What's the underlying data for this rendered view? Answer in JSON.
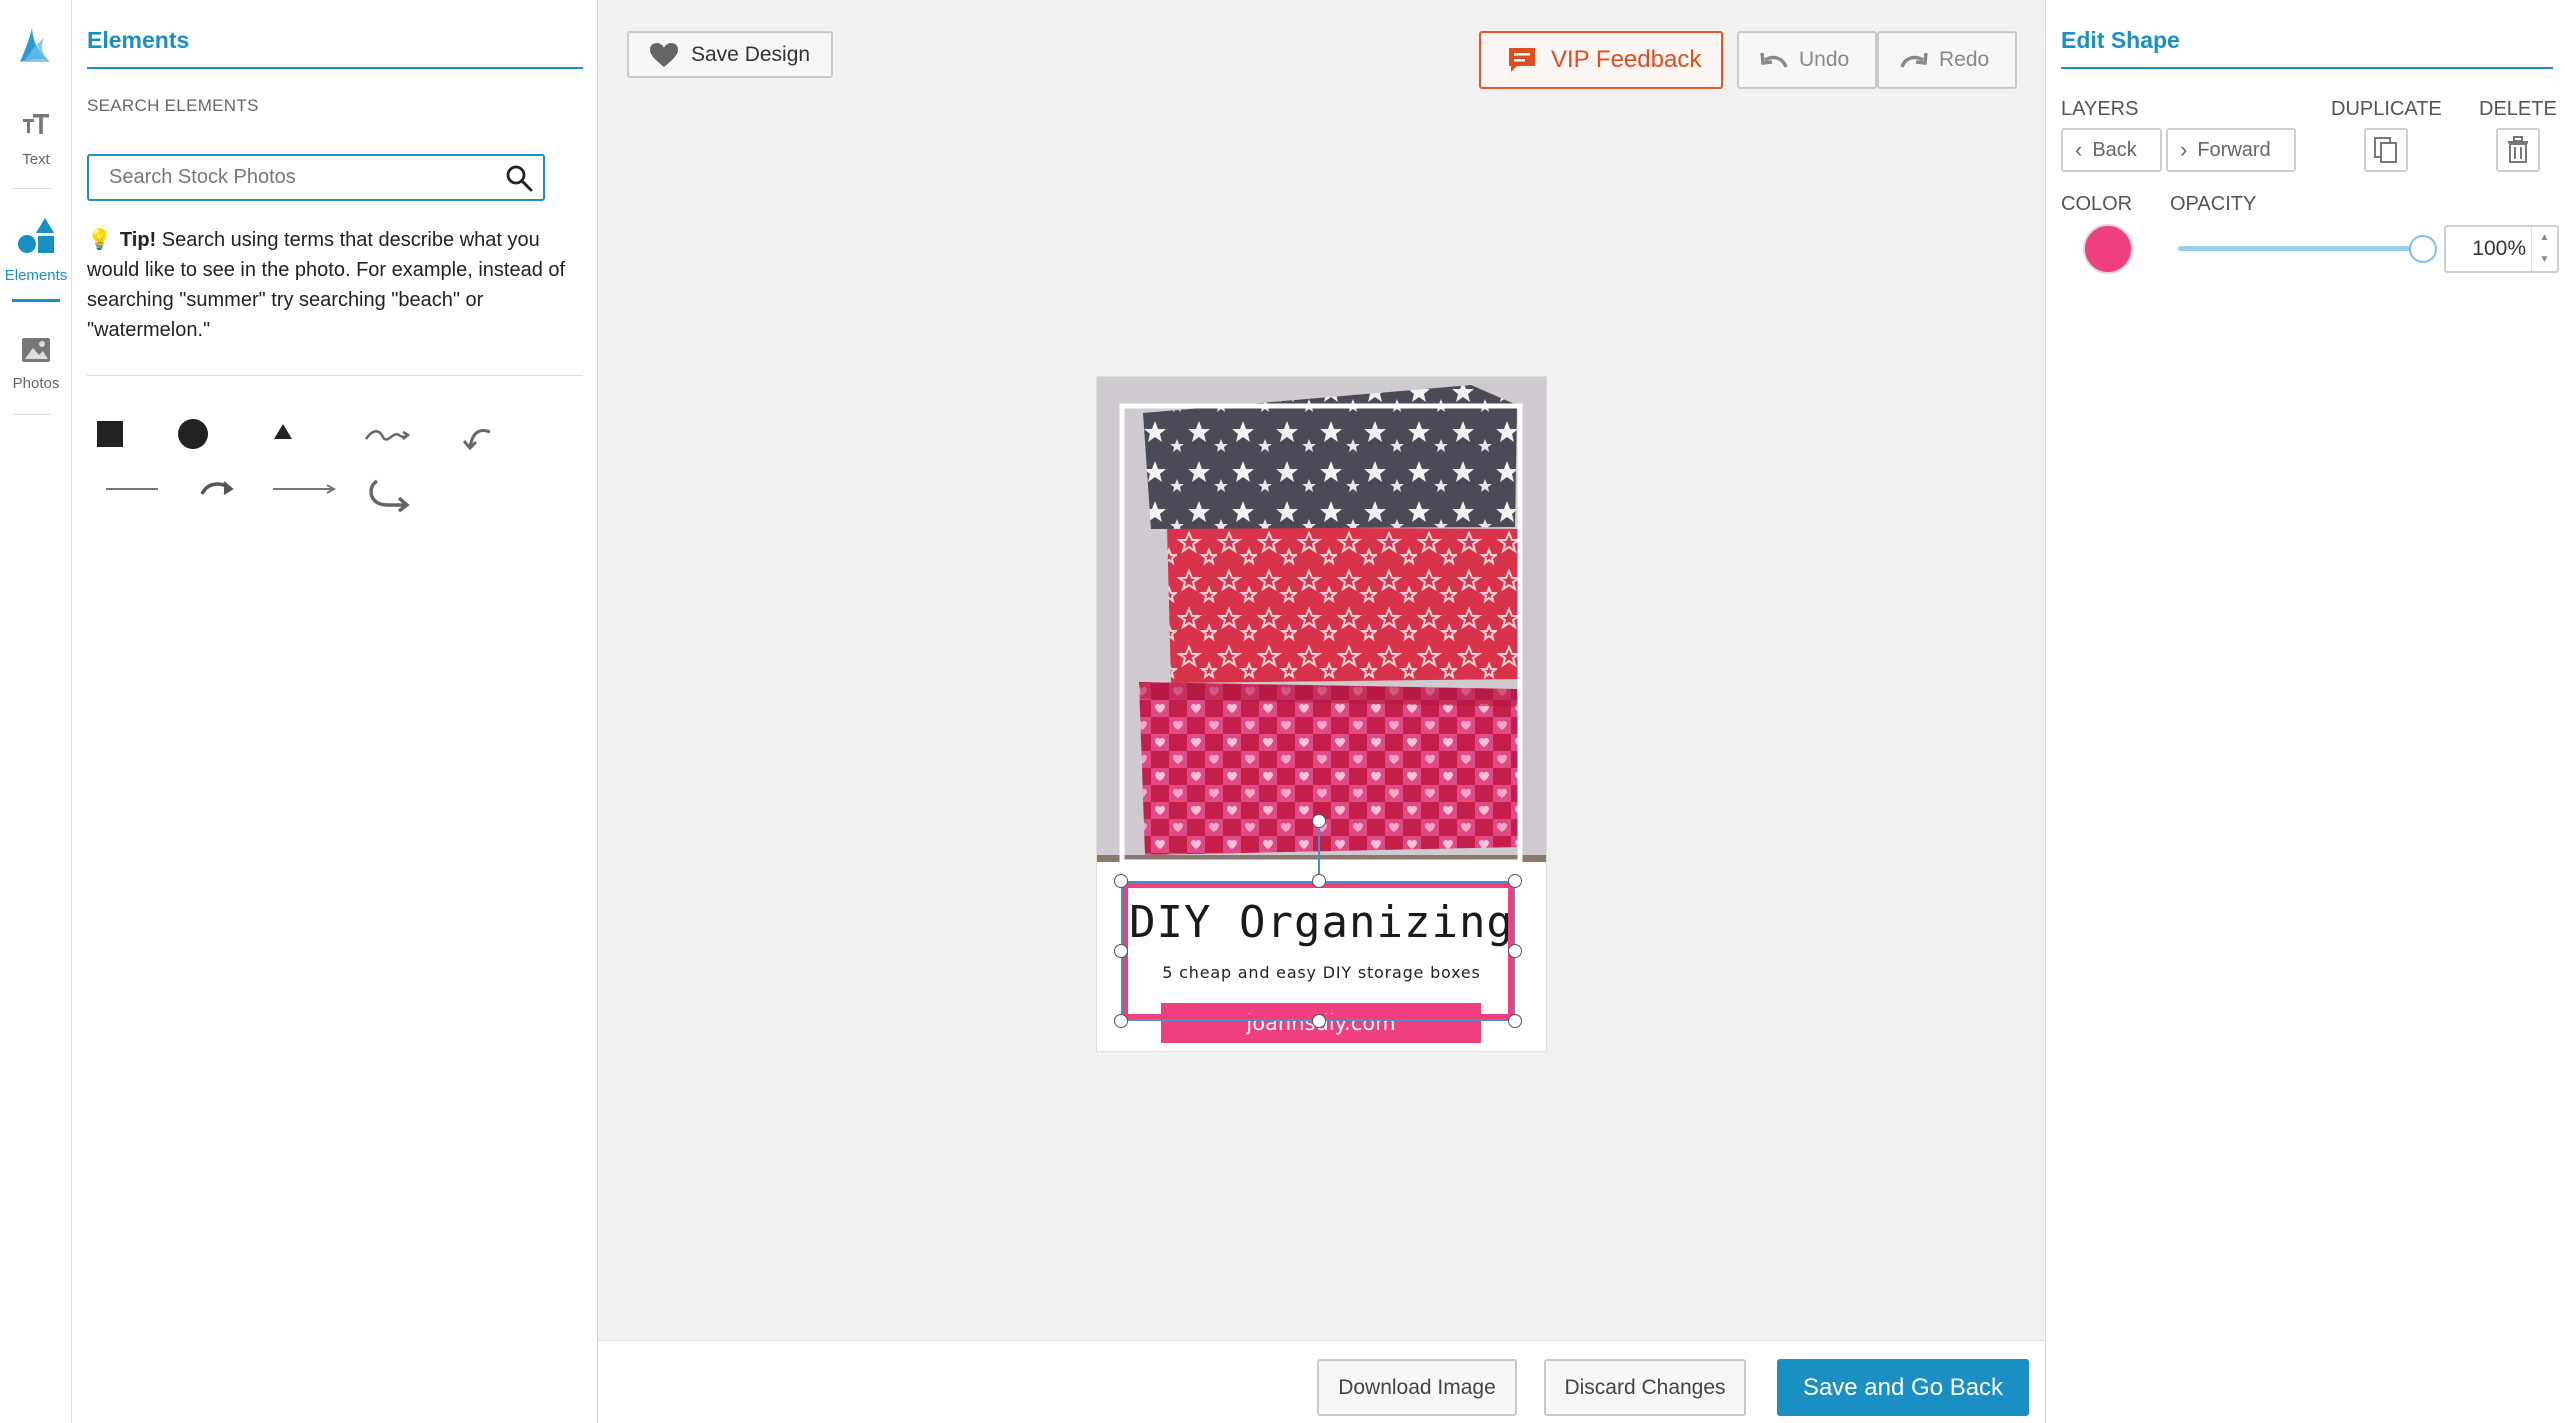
{
  "nav": {
    "items": [
      {
        "label": "Text",
        "icon": "text-size-icon"
      },
      {
        "label": "Elements",
        "icon": "shapes-icon"
      },
      {
        "label": "Photos",
        "icon": "image-icon"
      }
    ],
    "active": "Elements"
  },
  "elements_panel": {
    "title": "Elements",
    "section_label": "SEARCH ELEMENTS",
    "search": {
      "placeholder": "Search Stock Photos",
      "value": ""
    },
    "tip": {
      "bold": "Tip!",
      "text": " Search using terms that describe what you would like to see in the photo. For example, instead of searching \"summer\" try searching \"beach\" or \"watermelon.\""
    },
    "shapes": [
      "square",
      "circle",
      "triangle",
      "squiggle-arrow",
      "curved-back-arrow",
      "line",
      "curved-arrow",
      "arrow-line",
      "u-turn-arrow"
    ]
  },
  "toolbar": {
    "save_design": "Save Design",
    "vip_feedback": "VIP Feedback",
    "undo": "Undo",
    "redo": "Redo"
  },
  "design": {
    "title": "DIY Organizing",
    "subtitle": "5 cheap and easy DIY storage boxes",
    "url": "joannsdiy.com"
  },
  "actions": {
    "download": "Download Image",
    "discard": "Discard Changes",
    "save_back": "Save and Go Back"
  },
  "edit_shape": {
    "title": "Edit Shape",
    "layers_label": "LAYERS",
    "back": "Back",
    "forward": "Forward",
    "duplicate_label": "DUPLICATE",
    "delete_label": "DELETE",
    "color_label": "COLOR",
    "opacity_label": "OPACITY",
    "opacity_value": "100%",
    "opacity_level": 1.0,
    "color": "#ef3f7f"
  },
  "colors": {
    "accent": "#1a8fc4",
    "vip": "#e24d1c",
    "shape_pink": "#ef3f7f"
  }
}
